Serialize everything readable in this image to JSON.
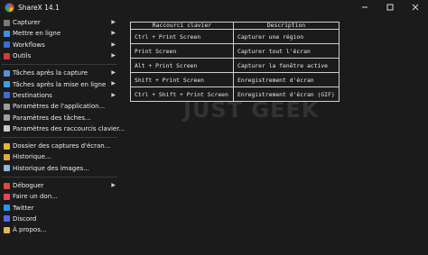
{
  "window": {
    "title": "ShareX 14.1"
  },
  "menu": {
    "group1": [
      {
        "label": "Capturer",
        "icon": "camera-icon",
        "color": "#7a7a7a",
        "submenu": true
      },
      {
        "label": "Mettre en ligne",
        "icon": "upload-arrow-icon",
        "color": "#3b8fe6",
        "submenu": true
      },
      {
        "label": "Workflows",
        "icon": "workflow-icon",
        "color": "#3a6fc4",
        "submenu": true
      },
      {
        "label": "Outils",
        "icon": "toolbox-icon",
        "color": "#d23b3b",
        "submenu": true
      }
    ],
    "group2": [
      {
        "label": "Tâches après la capture",
        "icon": "image-gear-icon",
        "color": "#5b8fd1",
        "submenu": true
      },
      {
        "label": "Tâches après la mise en ligne",
        "icon": "upload-gear-icon",
        "color": "#3aa0e6",
        "submenu": true
      },
      {
        "label": "Destinations",
        "icon": "globe-icon",
        "color": "#3b6fd1",
        "submenu": true
      },
      {
        "label": "Paramètres de l'application...",
        "icon": "settings-icon",
        "color": "#9b9b9b",
        "submenu": false
      },
      {
        "label": "Paramètres des tâches...",
        "icon": "gear-icon",
        "color": "#a0a0a0",
        "submenu": false
      },
      {
        "label": "Paramètres des raccourcis clavier...",
        "icon": "keyboard-icon",
        "color": "#c8c8c8",
        "submenu": false
      }
    ],
    "group3": [
      {
        "label": "Dossier des captures d'écran...",
        "icon": "folder-icon",
        "color": "#e2b33c",
        "submenu": false
      },
      {
        "label": "Historique...",
        "icon": "history-icon",
        "color": "#d9a94a",
        "submenu": false
      },
      {
        "label": "Historique des images...",
        "icon": "image-history-icon",
        "color": "#8fb7e0",
        "submenu": false
      }
    ],
    "group4": [
      {
        "label": "Déboguer",
        "icon": "bug-icon",
        "color": "#e0483c",
        "submenu": true
      },
      {
        "label": "Faire un don...",
        "icon": "heart-icon",
        "color": "#e2465a",
        "submenu": false
      },
      {
        "label": "Twitter",
        "icon": "twitter-icon",
        "color": "#1d9bf0",
        "submenu": false
      },
      {
        "label": "Discord",
        "icon": "discord-icon",
        "color": "#5865f2",
        "submenu": false
      },
      {
        "label": "À propos...",
        "icon": "crown-icon",
        "color": "#e6b84a",
        "submenu": false
      }
    ]
  },
  "shortcuts": {
    "headers": [
      "Raccourci clavier",
      "Description"
    ],
    "rows": [
      [
        "Ctrl + Print Screen",
        "Capturer une région"
      ],
      [
        "Print Screen",
        "Capturer tout l'écran"
      ],
      [
        "Alt + Print Screen",
        "Capturer la fenêtre active"
      ],
      [
        "Shift + Print Screen",
        "Enregistrement d'écran"
      ],
      [
        "Ctrl + Shift + Print Screen",
        "Enregistrement d'écran (GIF)"
      ]
    ]
  },
  "watermark": "JUST GEEK"
}
